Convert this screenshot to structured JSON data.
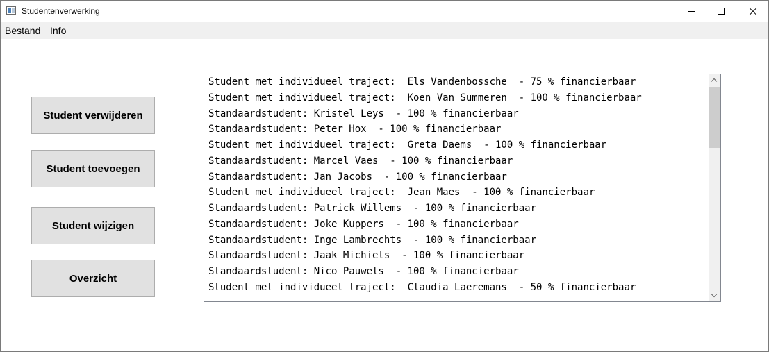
{
  "window": {
    "title": "Studentenverwerking"
  },
  "menu": {
    "items": [
      {
        "label": "Bestand"
      },
      {
        "label": "Info"
      }
    ]
  },
  "buttons": {
    "delete": "Student verwijderen",
    "add": "Student toevoegen",
    "edit": "Student wijzigen",
    "overview": "Overzicht"
  },
  "list": {
    "items": [
      "Student met individueel traject:  Els Vandenbossche  - 75 % financierbaar",
      "Student met individueel traject:  Koen Van Summeren  - 100 % financierbaar",
      "Standaardstudent: Kristel Leys  - 100 % financierbaar",
      "Standaardstudent: Peter Hox  - 100 % financierbaar",
      "Student met individueel traject:  Greta Daems  - 100 % financierbaar",
      "Standaardstudent: Marcel Vaes  - 100 % financierbaar",
      "Standaardstudent: Jan Jacobs  - 100 % financierbaar",
      "Student met individueel traject:  Jean Maes  - 100 % financierbaar",
      "Standaardstudent: Patrick Willems  - 100 % financierbaar",
      "Standaardstudent: Joke Kuppers  - 100 % financierbaar",
      "Standaardstudent: Inge Lambrechts  - 100 % financierbaar",
      "Standaardstudent: Jaak Michiels  - 100 % financierbaar",
      "Standaardstudent: Nico Pauwels  - 100 % financierbaar",
      "Student met individueel traject:  Claudia Laeremans  - 50 % financierbaar"
    ]
  },
  "icons": {
    "app": "app-window-icon",
    "minimize": "minimize-icon",
    "maximize": "maximize-icon",
    "close": "close-icon",
    "scroll_up": "chevron-up-icon",
    "scroll_down": "chevron-down-icon"
  },
  "colors": {
    "menubar": "#f0f0f0",
    "button_face": "#e1e1e1",
    "button_border": "#adadad",
    "scroll_thumb": "#cdcdcd"
  }
}
